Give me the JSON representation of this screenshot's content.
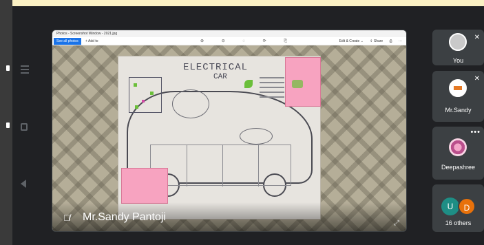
{
  "meeting": {
    "presenter_name": "Mr.Sandy Pantoji"
  },
  "viewer": {
    "window_title": "Photos - Screenshot Window - 2021.jpg",
    "see_all_label": "See all photos",
    "add_to_label": "+ Add to",
    "tool_icons": "⊕ ⊖ ◌ ⟳ ⎘",
    "edit_create_label": "Edit & Create ⌄",
    "share_label": "⇪ Share",
    "print_label": "⎙",
    "more_label": "···"
  },
  "poster": {
    "heading_line1": "ELECTRICAL",
    "heading_line2": "CAR"
  },
  "participants": [
    {
      "name": "You",
      "muted": true
    },
    {
      "name": "Mr.Sandy",
      "muted": true
    },
    {
      "name": "Deepashree",
      "more": "•••"
    },
    {
      "name": "16 others",
      "initials": [
        "U",
        "D"
      ]
    }
  ]
}
